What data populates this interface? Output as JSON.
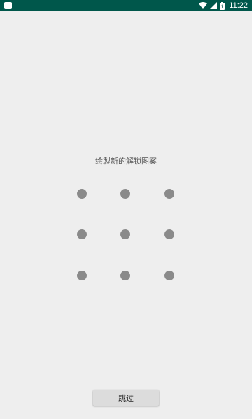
{
  "status_bar": {
    "time": "11:22",
    "bg_color": "#00574b",
    "icons": [
      "notification-icon",
      "wifi-icon",
      "signal-icon",
      "battery-icon"
    ]
  },
  "main": {
    "title": "绘製新的解锁图案",
    "pattern": {
      "rows": 3,
      "cols": 3,
      "dot_color": "#8a8a8a"
    },
    "skip_label": "跳过"
  }
}
